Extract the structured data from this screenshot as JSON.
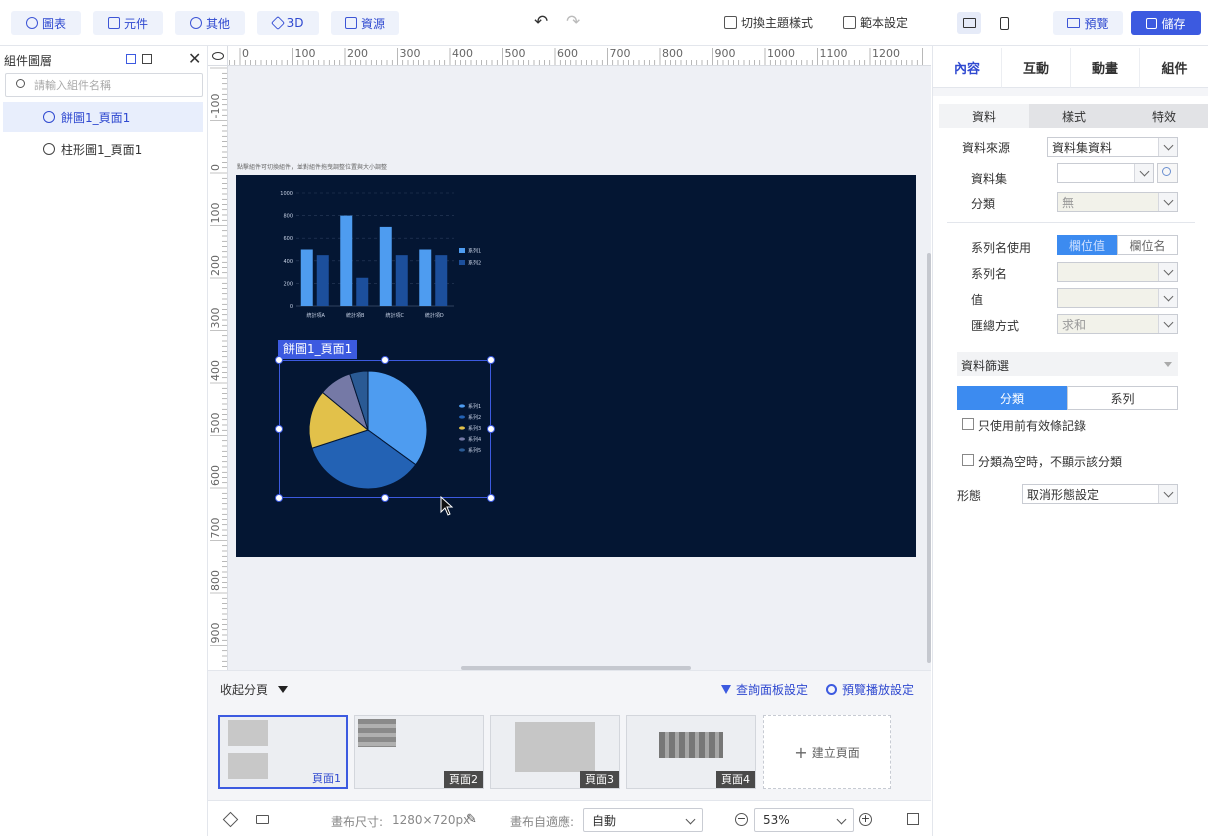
{
  "toolbar": {
    "chart_btn": "圖表",
    "widget_btn": "元件",
    "other_btn": "其他",
    "three_d_btn": "3D",
    "resource_btn": "資源",
    "theme_btn": "切換主題樣式",
    "template_btn": "範本設定",
    "preview_btn": "預覽",
    "save_btn": "儲存"
  },
  "left": {
    "title": "組件圖層",
    "search_placeholder": "請輸入組件名稱",
    "layers": [
      {
        "label": "餅圖1_頁面1",
        "selected": true
      },
      {
        "label": "柱形圖1_頁面1",
        "selected": false
      }
    ]
  },
  "canvas": {
    "hint": "點擊組件可切換組件，並對組件拖曳調整位置與大小調整",
    "selected_label": "餅圖1_頁面1",
    "ruler_top": [
      "0",
      "100",
      "200",
      "300",
      "400",
      "500",
      "600",
      "700",
      "800",
      "900",
      "1000",
      "1100",
      "1200"
    ],
    "ruler_left": [
      "-100",
      "0",
      "100",
      "200",
      "300",
      "400",
      "500",
      "600",
      "700",
      "800",
      "900"
    ]
  },
  "chart_data": [
    {
      "type": "bar",
      "categories": [
        "統計項A",
        "統計項B",
        "統計項C",
        "統計項D"
      ],
      "series": [
        {
          "name": "系列1",
          "values": [
            500,
            800,
            700,
            500
          ]
        },
        {
          "name": "系列2",
          "values": [
            450,
            250,
            450,
            450
          ]
        }
      ],
      "y_ticks": [
        "0",
        "200",
        "400",
        "600",
        "800",
        "1000"
      ],
      "ylim": [
        0,
        1000
      ],
      "legend": "right",
      "grid": true,
      "colors": [
        "#4e9cf0",
        "#1c4f9c"
      ]
    },
    {
      "type": "pie",
      "labels": [
        "系列1",
        "系列2",
        "系列3",
        "系列4",
        "系列5"
      ],
      "values": [
        35,
        35,
        16,
        9,
        5
      ],
      "colors": [
        "#4e9cf0",
        "#2362b4",
        "#e2c14a",
        "#7579a6",
        "#2a5a94"
      ],
      "legend": "right"
    }
  ],
  "pages": {
    "collapse_label": "收起分頁",
    "query_panel": "查詢面板設定",
    "preview_settings": "預覽播放設定",
    "thumbs": [
      "頁面1",
      "頁面2",
      "頁面3",
      "頁面4"
    ],
    "add_page": "建立頁面"
  },
  "status": {
    "canvas_size_label": "畫布尺寸:",
    "canvas_size": "1280×720px",
    "fit_label": "畫布自適應:",
    "fit_value": "自動",
    "zoom": "53%"
  },
  "right": {
    "tabs": [
      "內容",
      "互動",
      "動畫",
      "組件"
    ],
    "subtabs": [
      "資料",
      "樣式",
      "特效"
    ],
    "source_label": "資料來源",
    "source_value": "資料集資料",
    "dataset_label": "資料集",
    "category_label": "分類",
    "category_value": "無",
    "series_use_label": "系列名使用",
    "series_use_opt1": "欄位值",
    "series_use_opt2": "欄位名",
    "series_name_label": "系列名",
    "value_label": "值",
    "agg_label": "匯總方式",
    "agg_value": "求和",
    "filter_label": "資料篩選",
    "filter_tab1": "分類",
    "filter_tab2": "系列",
    "only_valid": "只使用前有效條記錄",
    "hide_empty": "分類為空時，不顯示該分類",
    "shape_label": "形態",
    "shape_value": "取消形態設定"
  },
  "colors": {
    "accent": "#3c5ae0",
    "stage_bg": "#041633"
  }
}
